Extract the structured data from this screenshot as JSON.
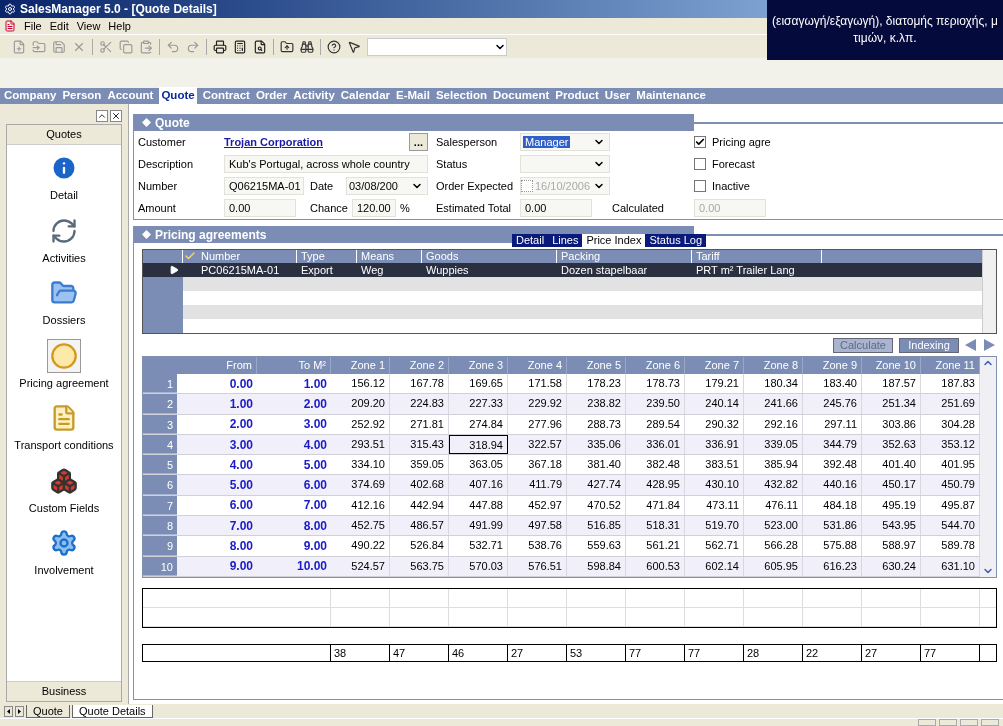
{
  "window": {
    "title": "SalesManager 5.0 - [Quote Details]"
  },
  "caption": {
    "lines": [
      "(εισαγωγή/εξαγωγή), διατομής περιοχής, μ",
      "τιμών, κ.λπ."
    ]
  },
  "menu": [
    "File",
    "Edit",
    "View",
    "Help"
  ],
  "nav": [
    {
      "label": "Company",
      "selected": false
    },
    {
      "label": "Person",
      "selected": false
    },
    {
      "label": "Account",
      "selected": false
    },
    {
      "label": "Quote",
      "selected": true
    },
    {
      "label": "Contract",
      "selected": false
    },
    {
      "label": "Order",
      "selected": false
    },
    {
      "label": "Activity",
      "selected": false
    },
    {
      "label": "Calendar",
      "selected": false
    },
    {
      "label": "E-Mail",
      "selected": false
    },
    {
      "label": "Selection",
      "selected": false
    },
    {
      "label": "Document",
      "selected": false
    },
    {
      "label": "Product",
      "selected": false
    },
    {
      "label": "User",
      "selected": false
    },
    {
      "label": "Maintenance",
      "selected": false
    }
  ],
  "sidebar": {
    "header": "Quotes",
    "footer": "Business",
    "items": [
      {
        "kind": "info",
        "label": "Detail",
        "selected": false
      },
      {
        "kind": "activities",
        "label": "Activities",
        "selected": false
      },
      {
        "kind": "dossiers",
        "label": "Dossiers",
        "selected": false
      },
      {
        "kind": "pricing",
        "label": "Pricing agreement",
        "selected": true
      },
      {
        "kind": "transport",
        "label": "Transport conditions",
        "selected": false
      },
      {
        "kind": "custom",
        "label": "Custom Fields",
        "selected": false
      },
      {
        "kind": "involvement",
        "label": "Involvement",
        "selected": false
      }
    ]
  },
  "quote": {
    "title": "Quote",
    "customer": {
      "label": "Customer",
      "value": "Trojan Corporation",
      "button": "..."
    },
    "description": {
      "label": "Description",
      "value": "Kub's Portugal, across whole country"
    },
    "number": {
      "label": "Number",
      "value": "Q06215MA-01"
    },
    "date": {
      "label": "Date",
      "value": "03/08/200"
    },
    "amount": {
      "label": "Amount",
      "value": "0.00"
    },
    "chance": {
      "label": "Chance",
      "value": "120.00",
      "unit": "%"
    },
    "salesperson": {
      "label": "Salesperson",
      "value": "Manager"
    },
    "status": {
      "label": "Status"
    },
    "order_expected": {
      "label": "Order Expected",
      "value": "16/10/2006",
      "checked": false,
      "disabled": true
    },
    "estimated_total": {
      "label": "Estimated Total",
      "value": "0.00"
    },
    "calculated": {
      "label": "Calculated",
      "value": "0.00",
      "disabled": true
    },
    "checkboxes": [
      {
        "label": "Pricing agre",
        "checked": true
      },
      {
        "label": "Forecast",
        "checked": false
      },
      {
        "label": "Inactive",
        "checked": false
      }
    ]
  },
  "pricing": {
    "title": "Pricing agreements",
    "tabs": [
      {
        "label": "Detail",
        "selected": false
      },
      {
        "label": "Lines",
        "selected": false
      },
      {
        "label": "Price Index",
        "selected": true
      },
      {
        "label": "Status Log",
        "selected": false
      }
    ],
    "columns": [
      "Number",
      "Type",
      "Means",
      "Goods",
      "Packing",
      "Tariff"
    ],
    "rows": [
      {
        "selected": true,
        "cells": [
          "PC06215MA-01",
          "Export",
          "Weg",
          "Wuppies",
          "Dozen stapelbaar",
          "PRT m²  Trailer Lang"
        ]
      }
    ],
    "buttons": [
      {
        "label": "Calculate",
        "disabled": true
      },
      {
        "label": "Indexing",
        "disabled": false
      }
    ]
  },
  "price_table": {
    "columns": [
      "From",
      "To M²",
      "Zone 1",
      "Zone 2",
      "Zone 3",
      "Zone 4",
      "Zone 5",
      "Zone 6",
      "Zone 7",
      "Zone 8",
      "Zone 9",
      "Zone 10",
      "Zone 11"
    ],
    "rows": [
      {
        "index": "1",
        "from": "0.00",
        "to": "1.00",
        "zones": [
          {
            "value": "156.12",
            "selected": false
          },
          {
            "value": "167.78",
            "selected": false
          },
          {
            "value": "169.65",
            "selected": false
          },
          {
            "value": "171.58",
            "selected": false
          },
          {
            "value": "178.23",
            "selected": false
          },
          {
            "value": "178.73",
            "selected": false
          },
          {
            "value": "179.21",
            "selected": false
          },
          {
            "value": "180.34",
            "selected": false
          },
          {
            "value": "183.40",
            "selected": false
          },
          {
            "value": "187.57",
            "selected": false
          },
          {
            "value": "187.83",
            "selected": false
          }
        ]
      },
      {
        "index": "2",
        "from": "1.00",
        "to": "2.00",
        "zones": [
          {
            "value": "209.20",
            "selected": false
          },
          {
            "value": "224.83",
            "selected": false
          },
          {
            "value": "227.33",
            "selected": false
          },
          {
            "value": "229.92",
            "selected": false
          },
          {
            "value": "238.82",
            "selected": false
          },
          {
            "value": "239.50",
            "selected": false
          },
          {
            "value": "240.14",
            "selected": false
          },
          {
            "value": "241.66",
            "selected": false
          },
          {
            "value": "245.76",
            "selected": false
          },
          {
            "value": "251.34",
            "selected": false
          },
          {
            "value": "251.69",
            "selected": false
          }
        ]
      },
      {
        "index": "3",
        "from": "2.00",
        "to": "3.00",
        "zones": [
          {
            "value": "252.92",
            "selected": false
          },
          {
            "value": "271.81",
            "selected": false
          },
          {
            "value": "274.84",
            "selected": false
          },
          {
            "value": "277.96",
            "selected": false
          },
          {
            "value": "288.73",
            "selected": false
          },
          {
            "value": "289.54",
            "selected": false
          },
          {
            "value": "290.32",
            "selected": false
          },
          {
            "value": "292.16",
            "selected": false
          },
          {
            "value": "297.11",
            "selected": false
          },
          {
            "value": "303.86",
            "selected": false
          },
          {
            "value": "304.28",
            "selected": false
          }
        ]
      },
      {
        "index": "4",
        "from": "3.00",
        "to": "4.00",
        "zones": [
          {
            "value": "293.51",
            "selected": false
          },
          {
            "value": "315.43",
            "selected": false
          },
          {
            "value": "318.94",
            "selected": true
          },
          {
            "value": "322.57",
            "selected": false
          },
          {
            "value": "335.06",
            "selected": false
          },
          {
            "value": "336.01",
            "selected": false
          },
          {
            "value": "336.91",
            "selected": false
          },
          {
            "value": "339.05",
            "selected": false
          },
          {
            "value": "344.79",
            "selected": false
          },
          {
            "value": "352.63",
            "selected": false
          },
          {
            "value": "353.12",
            "selected": false
          }
        ]
      },
      {
        "index": "5",
        "from": "4.00",
        "to": "5.00",
        "zones": [
          {
            "value": "334.10",
            "selected": false
          },
          {
            "value": "359.05",
            "selected": false
          },
          {
            "value": "363.05",
            "selected": false
          },
          {
            "value": "367.18",
            "selected": false
          },
          {
            "value": "381.40",
            "selected": false
          },
          {
            "value": "382.48",
            "selected": false
          },
          {
            "value": "383.51",
            "selected": false
          },
          {
            "value": "385.94",
            "selected": false
          },
          {
            "value": "392.48",
            "selected": false
          },
          {
            "value": "401.40",
            "selected": false
          },
          {
            "value": "401.95",
            "selected": false
          }
        ]
      },
      {
        "index": "6",
        "from": "5.00",
        "to": "6.00",
        "zones": [
          {
            "value": "374.69",
            "selected": false
          },
          {
            "value": "402.68",
            "selected": false
          },
          {
            "value": "407.16",
            "selected": false
          },
          {
            "value": "411.79",
            "selected": false
          },
          {
            "value": "427.74",
            "selected": false
          },
          {
            "value": "428.95",
            "selected": false
          },
          {
            "value": "430.10",
            "selected": false
          },
          {
            "value": "432.82",
            "selected": false
          },
          {
            "value": "440.16",
            "selected": false
          },
          {
            "value": "450.17",
            "selected": false
          },
          {
            "value": "450.79",
            "selected": false
          }
        ]
      },
      {
        "index": "7",
        "from": "6.00",
        "to": "7.00",
        "zones": [
          {
            "value": "412.16",
            "selected": false
          },
          {
            "value": "442.94",
            "selected": false
          },
          {
            "value": "447.88",
            "selected": false
          },
          {
            "value": "452.97",
            "selected": false
          },
          {
            "value": "470.52",
            "selected": false
          },
          {
            "value": "471.84",
            "selected": false
          },
          {
            "value": "473.11",
            "selected": false
          },
          {
            "value": "476.11",
            "selected": false
          },
          {
            "value": "484.18",
            "selected": false
          },
          {
            "value": "495.19",
            "selected": false
          },
          {
            "value": "495.87",
            "selected": false
          }
        ]
      },
      {
        "index": "8",
        "from": "7.00",
        "to": "8.00",
        "zones": [
          {
            "value": "452.75",
            "selected": false
          },
          {
            "value": "486.57",
            "selected": false
          },
          {
            "value": "491.99",
            "selected": false
          },
          {
            "value": "497.58",
            "selected": false
          },
          {
            "value": "516.85",
            "selected": false
          },
          {
            "value": "518.31",
            "selected": false
          },
          {
            "value": "519.70",
            "selected": false
          },
          {
            "value": "523.00",
            "selected": false
          },
          {
            "value": "531.86",
            "selected": false
          },
          {
            "value": "543.95",
            "selected": false
          },
          {
            "value": "544.70",
            "selected": false
          }
        ]
      },
      {
        "index": "9",
        "from": "8.00",
        "to": "9.00",
        "zones": [
          {
            "value": "490.22",
            "selected": false
          },
          {
            "value": "526.84",
            "selected": false
          },
          {
            "value": "532.71",
            "selected": false
          },
          {
            "value": "538.76",
            "selected": false
          },
          {
            "value": "559.63",
            "selected": false
          },
          {
            "value": "561.21",
            "selected": false
          },
          {
            "value": "562.71",
            "selected": false
          },
          {
            "value": "566.28",
            "selected": false
          },
          {
            "value": "575.88",
            "selected": false
          },
          {
            "value": "588.97",
            "selected": false
          },
          {
            "value": "589.78",
            "selected": false
          }
        ]
      },
      {
        "index": "10",
        "from": "9.00",
        "to": "10.00",
        "zones": [
          {
            "value": "524.57",
            "selected": false
          },
          {
            "value": "563.75",
            "selected": false
          },
          {
            "value": "570.03",
            "selected": false
          },
          {
            "value": "576.51",
            "selected": false
          },
          {
            "value": "598.84",
            "selected": false
          },
          {
            "value": "600.53",
            "selected": false
          },
          {
            "value": "602.14",
            "selected": false
          },
          {
            "value": "605.95",
            "selected": false
          },
          {
            "value": "616.23",
            "selected": false
          },
          {
            "value": "630.24",
            "selected": false
          },
          {
            "value": "631.10",
            "selected": false
          }
        ]
      }
    ],
    "totals": [
      "38",
      "47",
      "46",
      "27",
      "53",
      "77",
      "77",
      "28",
      "22",
      "27",
      "77"
    ]
  },
  "sheet_tabs": [
    {
      "label": "Quote",
      "selected": false
    },
    {
      "label": "Quote Details",
      "selected": true
    }
  ]
}
